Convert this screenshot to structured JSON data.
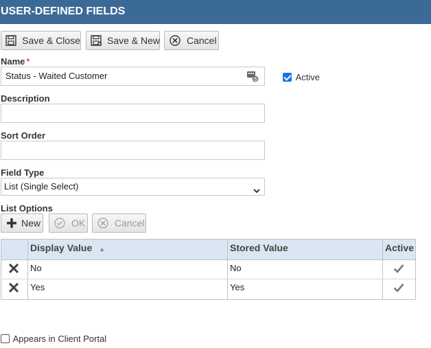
{
  "title": "USER-DEFINED FIELDS",
  "toolbar": {
    "save_close": "Save & Close",
    "save_new": "Save & New",
    "cancel": "Cancel"
  },
  "form": {
    "name_label": "Name",
    "required_mark": "*",
    "name_value": "Status - Waited Customer",
    "active_label": "Active",
    "active_checked": true,
    "description_label": "Description",
    "description_value": "",
    "sort_order_label": "Sort Order",
    "sort_order_value": "",
    "field_type_label": "Field Type",
    "field_type_value": "List (Single Select)",
    "list_options_label": "List Options"
  },
  "list_toolbar": {
    "new": "New",
    "ok": "OK",
    "cancel": "Cancel"
  },
  "grid": {
    "columns": [
      "Display Value",
      "Stored Value",
      "Active"
    ],
    "sort_indicator": "▲",
    "rows": [
      {
        "display": "No",
        "stored": "No",
        "active": true
      },
      {
        "display": "Yes",
        "stored": "Yes",
        "active": true
      }
    ]
  },
  "client_portal_label": "Appears in Client Portal",
  "client_portal_checked": false,
  "colors": {
    "titlebar": "#3c6a96",
    "grid_header": "#dae6f1",
    "active_check": "#1a73e8"
  }
}
